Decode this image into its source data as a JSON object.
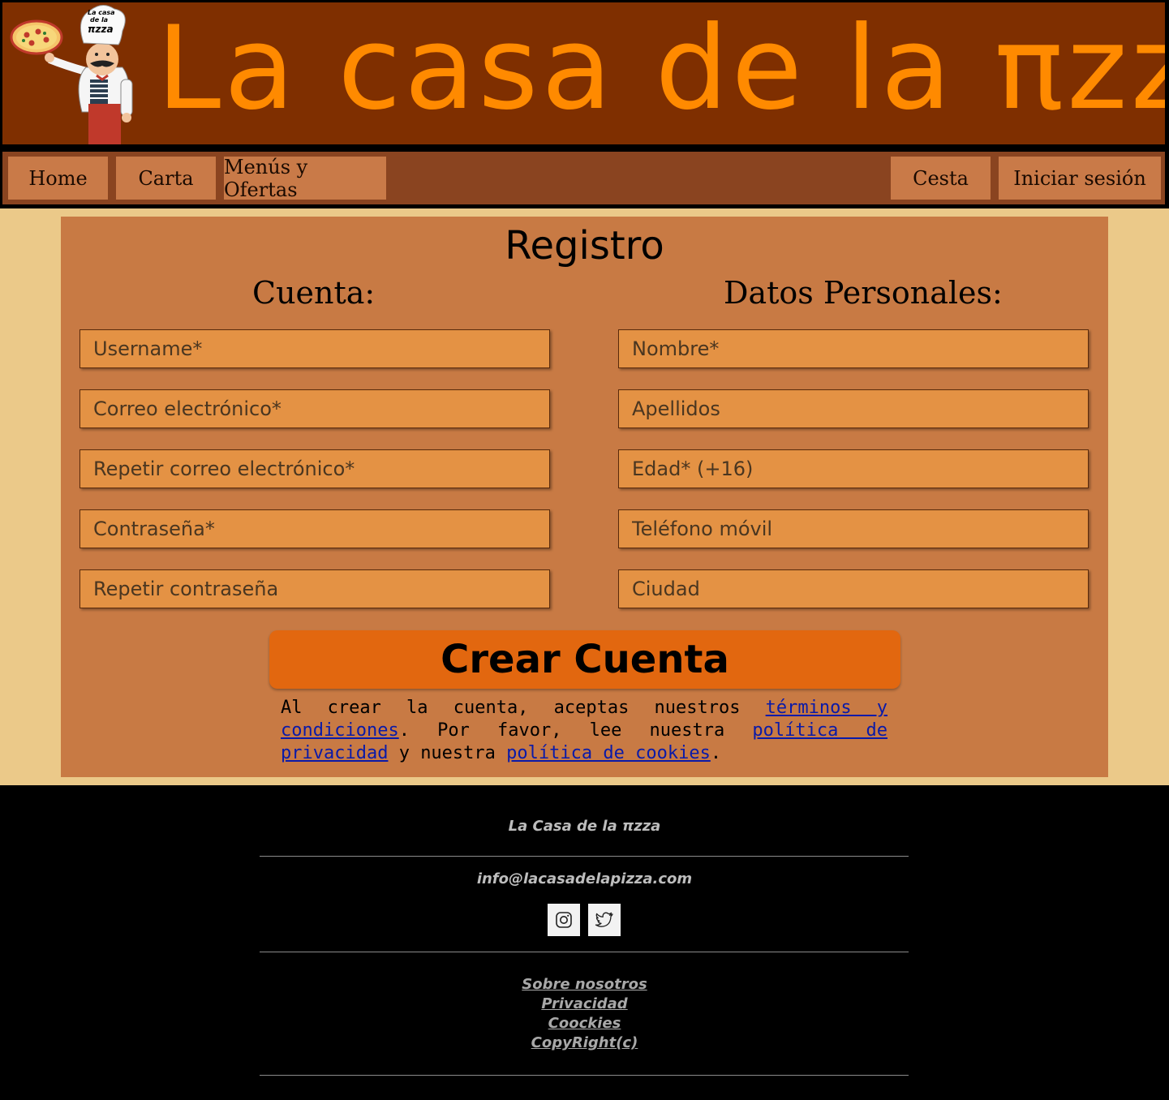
{
  "header": {
    "title": "La casa de la πzza",
    "logo_text_line1": "La casa",
    "logo_text_line2": "de la",
    "logo_text_line3": "πzza"
  },
  "nav": {
    "left": [
      {
        "label": "Home"
      },
      {
        "label": "Carta"
      },
      {
        "label": "Menús y Ofertas"
      }
    ],
    "right": [
      {
        "label": "Cesta"
      },
      {
        "label": "Iniciar sesión"
      }
    ]
  },
  "form": {
    "title": "Registro",
    "account_title": "Cuenta:",
    "personal_title": "Datos Personales:",
    "account_fields": [
      {
        "placeholder": "Username*"
      },
      {
        "placeholder": "Correo electrónico*"
      },
      {
        "placeholder": "Repetir correo electrónico*"
      },
      {
        "placeholder": "Contraseña*"
      },
      {
        "placeholder": "Repetir contraseña"
      }
    ],
    "personal_fields": [
      {
        "placeholder": "Nombre*"
      },
      {
        "placeholder": "Apellidos"
      },
      {
        "placeholder": "Edad* (+16)"
      },
      {
        "placeholder": "Teléfono móvil"
      },
      {
        "placeholder": "Ciudad"
      }
    ],
    "submit_label": "Crear Cuenta",
    "terms": {
      "t1": "Al crear la cuenta, aceptas nuestros ",
      "link_terms": "términos y condiciones",
      "t2": ". Por favor, lee nuestra ",
      "link_privacy": "política de privacidad",
      "t3": " y nuestra ",
      "link_cookies": "política de cookies",
      "t4": "."
    }
  },
  "footer": {
    "brand": "La Casa de la πzza",
    "email": "info@lacasadelapizza.com",
    "social": [
      {
        "icon": "instagram-icon"
      },
      {
        "icon": "twitter-icon"
      }
    ],
    "links": [
      {
        "label": "Sobre nosotros"
      },
      {
        "label": "Privacidad"
      },
      {
        "label": "Coockies"
      },
      {
        "label": "CopyRight(c)"
      }
    ]
  },
  "colors": {
    "header_bg": "#7f2f00",
    "title_orange": "#ff8a00",
    "nav_bg": "#8a4420",
    "nav_button": "#c97a48",
    "page_bg": "#ebc989",
    "panel_bg": "#c87a44",
    "field_bg": "#e49244",
    "submit_bg": "#e2670f",
    "link_blue": "#0a1aa8"
  }
}
